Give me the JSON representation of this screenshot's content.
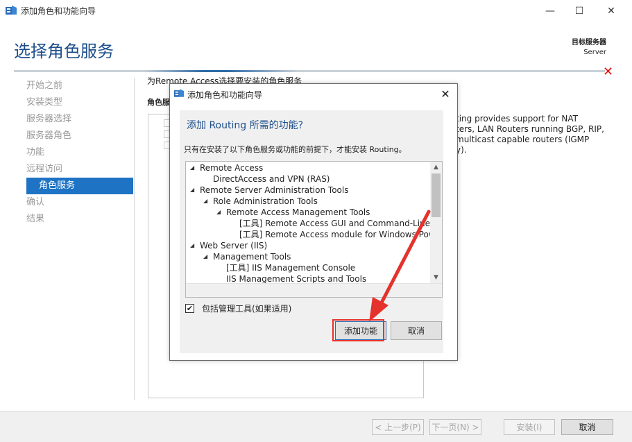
{
  "window": {
    "title": "添加角色和功能向导",
    "controls": {
      "minimize": "—",
      "maximize": "☐",
      "close": "✕"
    }
  },
  "header": {
    "page_title": "选择角色服务",
    "target_label": "目标服务器",
    "target_value": "Server"
  },
  "nav": {
    "items": [
      {
        "label": "开始之前",
        "active": false
      },
      {
        "label": "安装类型",
        "active": false
      },
      {
        "label": "服务器选择",
        "active": false
      },
      {
        "label": "服务器角色",
        "active": false
      },
      {
        "label": "功能",
        "active": false
      },
      {
        "label": "远程访问",
        "active": false
      },
      {
        "label": "角色服务",
        "active": true
      },
      {
        "label": "确认",
        "active": false
      },
      {
        "label": "结果",
        "active": false
      }
    ]
  },
  "content": {
    "description": "为Remote Access选择要安装的角色服务",
    "role_label": "角色服",
    "right_desc_lines": [
      "ting provides support for NAT",
      "ters, LAN Routers running BGP, RIP,",
      "multicast capable routers (IGMP",
      "y)."
    ]
  },
  "footer": {
    "prev": "< 上一步(P)",
    "next": "下一页(N) >",
    "install": "安装(I)",
    "cancel": "取消"
  },
  "dialog": {
    "title": "添加角色和功能向导",
    "heading": "添加 Routing 所需的功能?",
    "info": "只有在安装了以下角色服务或功能的前提下，才能安装 Routing。",
    "tree": [
      {
        "label": "Remote Access",
        "level": 0,
        "expander": "◢"
      },
      {
        "label": "DirectAccess and VPN (RAS)",
        "level": 1,
        "expander": ""
      },
      {
        "label": "Remote Server Administration Tools",
        "level": 0,
        "expander": "◢"
      },
      {
        "label": "Role Administration Tools",
        "level": 1,
        "expander": "◢"
      },
      {
        "label": "Remote Access Management Tools",
        "level": 2,
        "expander": "◢"
      },
      {
        "label": "[工具] Remote Access GUI and Command-Line T",
        "level": 3,
        "expander": ""
      },
      {
        "label": "[工具] Remote Access module for Windows Pow",
        "level": 3,
        "expander": ""
      },
      {
        "label": "Web Server (IIS)",
        "level": 0,
        "expander": "◢"
      },
      {
        "label": "Management Tools",
        "level": 1,
        "expander": "◢"
      },
      {
        "label": "[工具] IIS Management Console",
        "level": 2,
        "expander": ""
      },
      {
        "label": "IIS Management Scripts and Tools",
        "level": 2,
        "expander": ""
      }
    ],
    "include_tools_label": "包括管理工具(如果适用)",
    "include_tools_checked": true,
    "add_button": "添加功能",
    "cancel_button": "取消"
  },
  "accent_colors": {
    "title_blue": "#1e4f8c",
    "nav_active": "#1e73c4",
    "annotation_red": "#e5322c"
  }
}
